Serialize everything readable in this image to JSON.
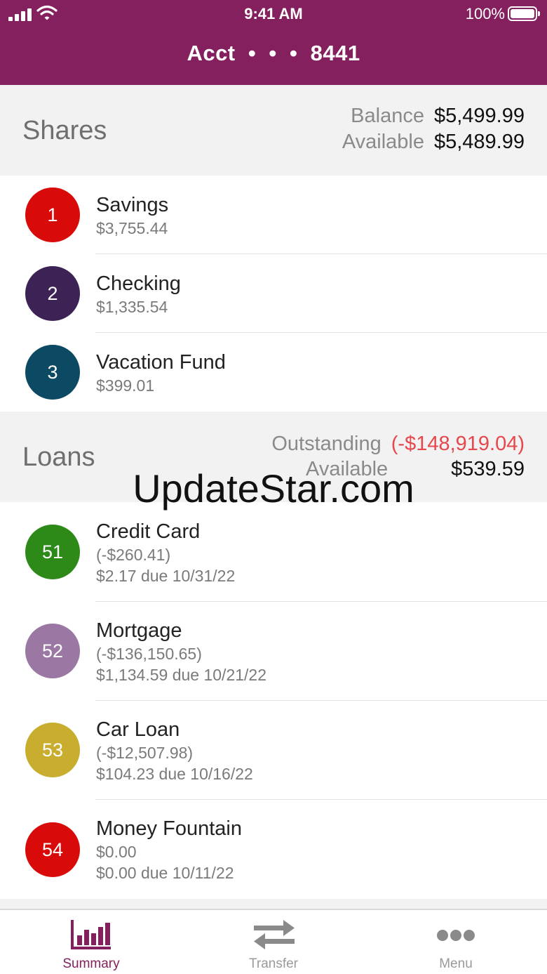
{
  "status_bar": {
    "time": "9:41 AM",
    "battery_percent": "100%"
  },
  "header": {
    "account_title": "Acct  •  •  •  8441"
  },
  "shares": {
    "title": "Shares",
    "balance_label": "Balance",
    "balance_value": "$5,499.99",
    "available_label": "Available",
    "available_value": "$5,489.99",
    "items": [
      {
        "badge": "1",
        "name": "Savings",
        "amount": "$3,755.44",
        "color": "#d80a0a"
      },
      {
        "badge": "2",
        "name": "Checking",
        "amount": "$1,335.54",
        "color": "#3d2256"
      },
      {
        "badge": "3",
        "name": "Vacation Fund",
        "amount": "$399.01",
        "color": "#0c4a63"
      }
    ]
  },
  "loans": {
    "title": "Loans",
    "outstanding_label": "Outstanding",
    "outstanding_value": "(-$148,919.04)",
    "available_label": "Available",
    "available_value": "$539.59",
    "items": [
      {
        "badge": "51",
        "name": "Credit Card",
        "balance": "(-$260.41)",
        "due": "$2.17 due 10/31/22",
        "color": "#2e8a18"
      },
      {
        "badge": "52",
        "name": "Mortgage",
        "balance": "(-$136,150.65)",
        "due": "$1,134.59 due 10/21/22",
        "color": "#9a78a3"
      },
      {
        "badge": "53",
        "name": "Car Loan",
        "balance": "(-$12,507.98)",
        "due": "$104.23 due 10/16/22",
        "color": "#c9ad2f"
      },
      {
        "badge": "54",
        "name": "Money Fountain",
        "balance": "$0.00",
        "due": "$0.00 due 10/11/22",
        "color": "#d80a0a"
      }
    ]
  },
  "watermark": "UpdateStar.com",
  "tabbar": {
    "tabs": [
      {
        "label": "Summary",
        "icon": "bar-chart-icon",
        "active": true
      },
      {
        "label": "Transfer",
        "icon": "swap-arrows-icon",
        "active": false
      },
      {
        "label": "Menu",
        "icon": "more-dots-icon",
        "active": false
      }
    ]
  },
  "colors": {
    "brand": "#85205f",
    "negative": "#e5484d",
    "inactive": "#9a9a9a"
  }
}
